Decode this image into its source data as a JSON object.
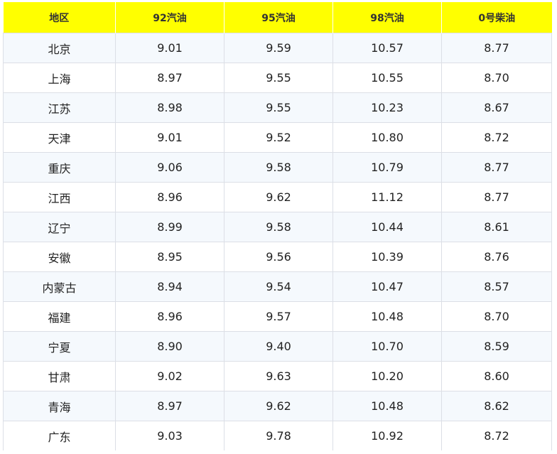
{
  "table": {
    "headers": [
      "地区",
      "92汽油",
      "95汽油",
      "98汽油",
      "0号柴油"
    ],
    "rows": [
      [
        "北京",
        "9.01",
        "9.59",
        "10.57",
        "8.77"
      ],
      [
        "上海",
        "8.97",
        "9.55",
        "10.55",
        "8.70"
      ],
      [
        "江苏",
        "8.98",
        "9.55",
        "10.23",
        "8.67"
      ],
      [
        "天津",
        "9.01",
        "9.52",
        "10.80",
        "8.72"
      ],
      [
        "重庆",
        "9.06",
        "9.58",
        "10.79",
        "8.77"
      ],
      [
        "江西",
        "8.96",
        "9.62",
        "11.12",
        "8.77"
      ],
      [
        "辽宁",
        "8.99",
        "9.58",
        "10.44",
        "8.61"
      ],
      [
        "安徽",
        "8.95",
        "9.56",
        "10.39",
        "8.76"
      ],
      [
        "内蒙古",
        "8.94",
        "9.54",
        "10.47",
        "8.57"
      ],
      [
        "福建",
        "8.96",
        "9.57",
        "10.48",
        "8.70"
      ],
      [
        "宁夏",
        "8.90",
        "9.40",
        "10.70",
        "8.59"
      ],
      [
        "甘肃",
        "9.02",
        "9.63",
        "10.20",
        "8.60"
      ],
      [
        "青海",
        "8.97",
        "9.62",
        "10.48",
        "8.62"
      ],
      [
        "广东",
        "9.03",
        "9.78",
        "10.92",
        "8.72"
      ]
    ]
  },
  "colors": {
    "header_background": "#ffff00",
    "odd_row_background": "#f5f9fd",
    "border": "#dcdfe6"
  }
}
